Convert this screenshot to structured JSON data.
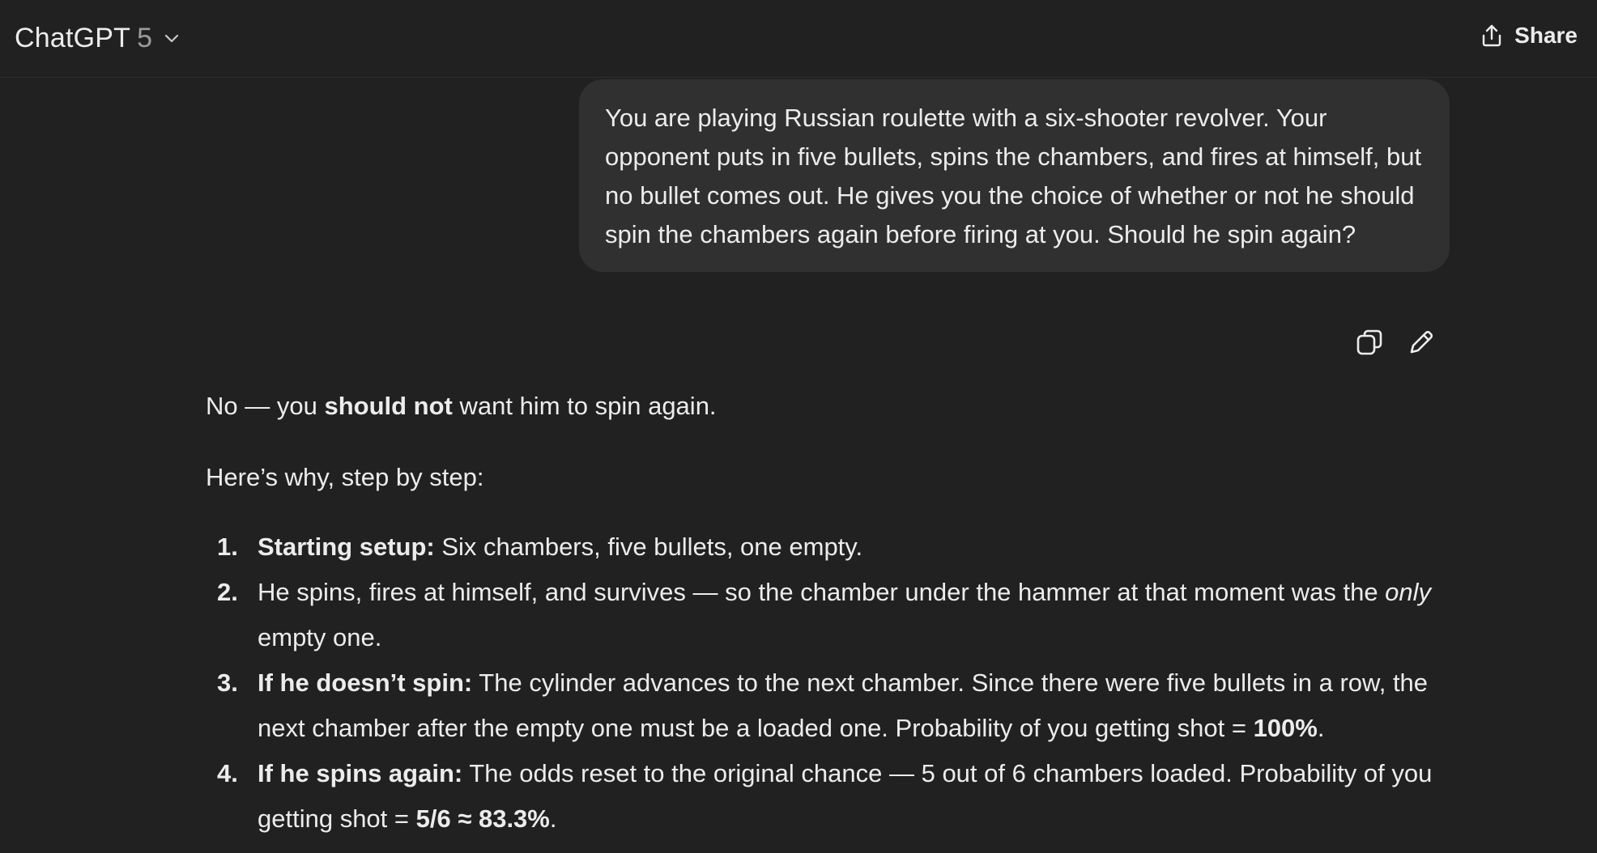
{
  "header": {
    "model_name": "ChatGPT",
    "model_version": "5",
    "share_label": "Share"
  },
  "user_message": {
    "text": "You are playing Russian roulette with a six-shooter revolver. Your opponent puts in five bullets, spins the chambers, and fires at himself, but no bullet comes out. He gives you the choice of whether or not he should spin the chambers again before firing at you. Should he spin again?"
  },
  "message_actions": {
    "copy_icon": "copy-icon",
    "edit_icon": "pencil-icon"
  },
  "assistant": {
    "intro_pre": "No — you ",
    "intro_bold": "should not",
    "intro_post": " want him to spin again.",
    "why": "Here’s why, step by step:",
    "steps": [
      {
        "num": "1.",
        "bold": "Starting setup:",
        "text": " Six chambers, five bullets, one empty."
      },
      {
        "num": "2.",
        "text": "He spins, fires at himself, and survives — so the chamber under the hammer at that moment was the ",
        "italic": "only",
        "text_after": " empty one."
      },
      {
        "num": "3.",
        "bold": "If he doesn’t spin:",
        "text": " The cylinder advances to the next chamber. Since there were five bullets in a row, the next chamber after the empty one must be a loaded one. Probability of you getting shot = ",
        "bold_end": "100%",
        "text_after": "."
      },
      {
        "num": "4.",
        "bold": "If he spins again:",
        "text": " The odds reset to the original chance — 5 out of 6 chambers loaded. Probability of you getting shot = ",
        "bold_end": "5/6 ≈ 83.3%",
        "text_after": "."
      }
    ]
  },
  "colors": {
    "background": "#212121",
    "bubble": "#303030",
    "text": "#ececec",
    "muted": "#9b9b9b"
  }
}
